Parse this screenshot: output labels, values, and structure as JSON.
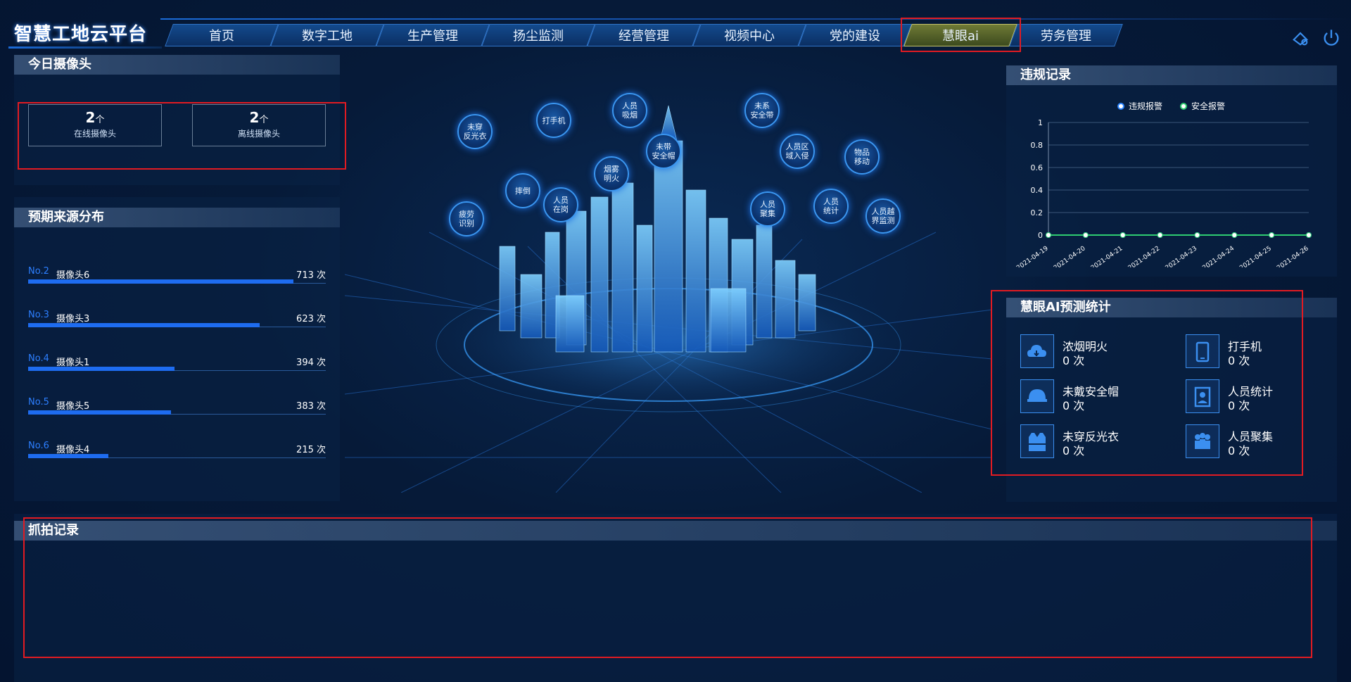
{
  "app": {
    "title": "智慧工地云平台"
  },
  "nav": {
    "items": [
      "首页",
      "数字工地",
      "生产管理",
      "扬尘监测",
      "经营管理",
      "视频中心",
      "党的建设",
      "慧眼ai",
      "劳务管理"
    ],
    "active": "慧眼ai"
  },
  "top_icons": [
    "maintenance-icon",
    "power-icon"
  ],
  "cameras": {
    "title": "今日摄像头",
    "online": {
      "count": "2",
      "unit": "个",
      "label": "在线摄像头"
    },
    "offline": {
      "count": "2",
      "unit": "个",
      "label": "离线摄像头"
    }
  },
  "sources": {
    "title": "预期来源分布",
    "max_value": 800,
    "items": [
      {
        "rank": "No.2",
        "name": "摄像头6",
        "value": 713,
        "value_label": "713 次"
      },
      {
        "rank": "No.3",
        "name": "摄像头3",
        "value": 623,
        "value_label": "623 次"
      },
      {
        "rank": "No.4",
        "name": "摄像头1",
        "value": 394,
        "value_label": "394 次"
      },
      {
        "rank": "No.5",
        "name": "摄像头5",
        "value": 383,
        "value_label": "383 次"
      },
      {
        "rank": "No.6",
        "name": "摄像头4",
        "value": 215,
        "value_label": "215 次"
      }
    ]
  },
  "bubbles": [
    "未穿\n反光衣",
    "打手机",
    "人员\n吸烟",
    "未系\n安全带",
    "未带\n安全帽",
    "人员区\n域入侵",
    "物品\n移动",
    "摔倒",
    "烟雾\n明火",
    "人员\n在岗",
    "人员\n聚集",
    "人员\n统计",
    "人员越\n界监测",
    "疲劳\n识别"
  ],
  "violations": {
    "title": "违规记录",
    "legend": [
      "违规报警",
      "安全报警"
    ]
  },
  "chart_data": {
    "type": "line",
    "x": [
      "2021-04-19",
      "2021-04-20",
      "2021-04-21",
      "2021-04-22",
      "2021-04-23",
      "2021-04-24",
      "2021-04-25",
      "2021-04-26"
    ],
    "series": [
      {
        "name": "违规报警",
        "values": [
          0,
          0,
          0,
          0,
          0,
          0,
          0,
          0
        ]
      },
      {
        "name": "安全报警",
        "values": [
          0,
          0,
          0,
          0,
          0,
          0,
          0,
          0
        ]
      }
    ],
    "yticks": [
      "1",
      "0.8",
      "0.6",
      "0.4",
      "0.2",
      "0"
    ],
    "ylim": [
      0,
      1
    ],
    "grid": true,
    "legend_position": "top"
  },
  "ai_stats": {
    "title": "慧眼AI预测统计",
    "items": [
      {
        "name": "浓烟明火",
        "value": "0 次",
        "icon": "cloud-fire-icon"
      },
      {
        "name": "打手机",
        "value": "0 次",
        "icon": "phone-icon"
      },
      {
        "name": "未戴安全帽",
        "value": "0 次",
        "icon": "helmet-icon"
      },
      {
        "name": "人员统计",
        "value": "0 次",
        "icon": "person-count-icon"
      },
      {
        "name": "未穿反光衣",
        "value": "0 次",
        "icon": "vest-icon"
      },
      {
        "name": "人员聚集",
        "value": "0 次",
        "icon": "crowd-icon"
      }
    ]
  },
  "snapshots": {
    "title": "抓拍记录"
  },
  "colors": {
    "accent": "#1e6cf0",
    "highlight": "#e11b22",
    "safe": "#2ecc71"
  }
}
